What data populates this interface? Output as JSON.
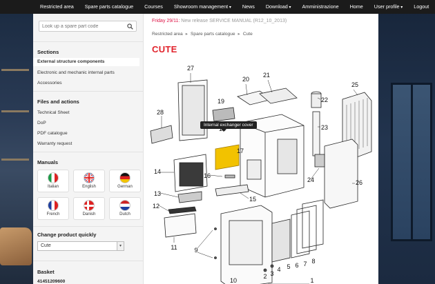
{
  "topnav": {
    "left": [
      {
        "label": "Restricted area",
        "caret": false
      },
      {
        "label": "Spare parts catalogue",
        "caret": false
      },
      {
        "label": "Courses",
        "caret": false
      },
      {
        "label": "Showroom management",
        "caret": true
      },
      {
        "label": "News",
        "caret": false
      },
      {
        "label": "Download",
        "caret": true
      },
      {
        "label": "Amministrazione",
        "caret": false
      }
    ],
    "right": [
      {
        "label": "Home",
        "caret": false
      },
      {
        "label": "User profile",
        "caret": true
      },
      {
        "label": "Logout",
        "caret": false
      }
    ]
  },
  "search": {
    "placeholder": "Look up a spare part code",
    "icon": "search-icon"
  },
  "sidebar": {
    "sections_title": "Sections",
    "sections": [
      {
        "label": "External structure components",
        "active": true
      },
      {
        "label": "Electronic and mechanic internal parts",
        "active": false
      },
      {
        "label": "Accessories",
        "active": false
      }
    ],
    "files_title": "Files and actions",
    "files": [
      "Technical Sheet",
      "DoP",
      "PDF catalogue",
      "Warranty request"
    ],
    "manuals_title": "Manuals",
    "manuals": [
      {
        "label": "Italian",
        "flag": "it"
      },
      {
        "label": "English",
        "flag": "uk"
      },
      {
        "label": "German",
        "flag": "de"
      },
      {
        "label": "French",
        "flag": "fr"
      },
      {
        "label": "Danish",
        "flag": "dk"
      },
      {
        "label": "Dutch",
        "flag": "nl"
      }
    ],
    "change_title": "Change product quickly",
    "product_selected": "Cute",
    "basket_title": "Basket",
    "basket_code": "41451209600"
  },
  "news": {
    "date": "Friday 29/11:",
    "text": " New release SERVICE MANUAL (R12_10_2013)"
  },
  "breadcrumb": [
    "Restricted area",
    "Spare parts catalogue",
    "Cute"
  ],
  "page_title": "CUTE",
  "tooltip": "Internal exchanger cover",
  "part_numbers": [
    "1",
    "2",
    "3",
    "4",
    "5",
    "6",
    "7",
    "8",
    "9",
    "10",
    "11",
    "12",
    "13",
    "14",
    "15",
    "16",
    "17",
    "18",
    "19",
    "20",
    "21",
    "22",
    "23",
    "24",
    "25",
    "26",
    "27",
    "28"
  ],
  "colors": {
    "accent": "#e1222b",
    "highlight": "#f2c200",
    "nav_bg": "#1b1b1b"
  }
}
